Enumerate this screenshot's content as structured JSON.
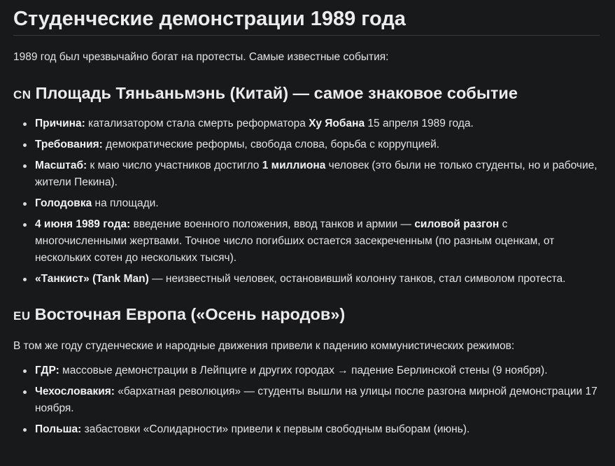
{
  "title": "Студенческие демонстрации 1989 года",
  "intro": "1989 год был чрезвычайно богат на протесты. Самые известные события:",
  "sections": [
    {
      "flag": "CN",
      "heading": "Площадь Тяньаньмэнь (Китай) — самое знаковое событие",
      "items": [
        {
          "b1": "Причина:",
          "t1": " катализатором стала смерть реформатора ",
          "b2": "Ху Яобана",
          "t2": " 15 апреля 1989 года."
        },
        {
          "b1": "Требования:",
          "t1": " демократические реформы, свобода слова, борьба с коррупцией."
        },
        {
          "b1": "Масштаб:",
          "t1": " к маю число участников достигло ",
          "b2": "1 миллиона",
          "t2": " человек (это были не только студенты, но и рабочие, жители Пекина)."
        },
        {
          "b1": "Голодовка",
          "t1": " на площади."
        },
        {
          "b1": "4 июня 1989 года:",
          "t1": " введение военного положения, ввод танков и армии — ",
          "b2": "силовой разгон",
          "t2": " с многочисленными жертвами. Точное число погибших остается засекреченным (по разным оценкам, от нескольких сотен до нескольких тысяч)."
        },
        {
          "b1": "«Танкист» (Tank Man)",
          "t1": " — неизвестный человек, остановивший колонну танков, стал символом протеста."
        }
      ]
    },
    {
      "flag": "EU",
      "heading": "Восточная Европа («Осень народов»)",
      "intro": "В том же году студенческие и народные движения привели к падению коммунистических режимов:",
      "items": [
        {
          "b1": "ГДР:",
          "t1": " массовые демонстрации в Лейпциге и других городах → падение Берлинской стены (9 ноября)."
        },
        {
          "b1": "Чехословакия:",
          "t1": " «бархатная революция» — студенты вышли на улицы после разгона мирной демонстрации 17 ноября."
        },
        {
          "b1": "Польша:",
          "t1": " забастовки «Солидарности» привели к первым свободным выборам (июнь)."
        }
      ]
    }
  ]
}
